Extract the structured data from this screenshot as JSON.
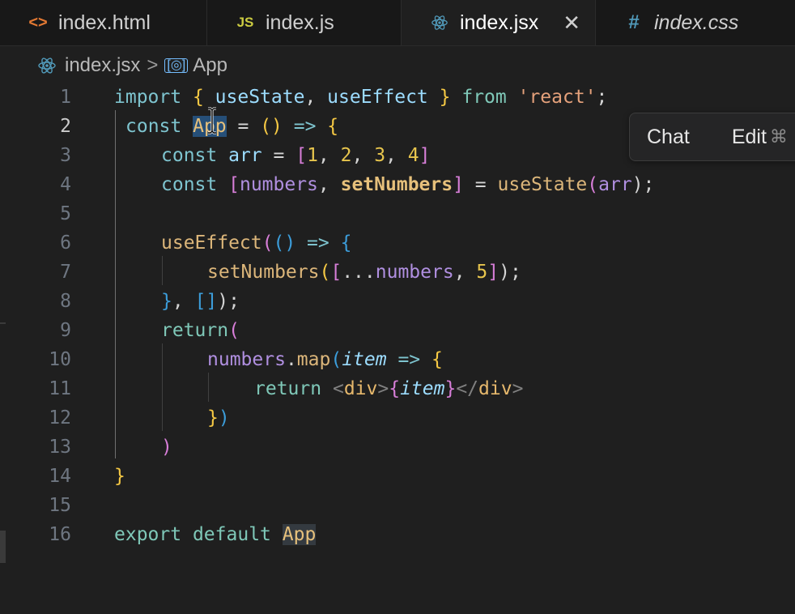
{
  "tabs": [
    {
      "label": "index.html",
      "icon": "html-icon",
      "glyph": "<>",
      "color": "#e37933"
    },
    {
      "label": "index.js",
      "icon": "js-icon",
      "glyph": "JS",
      "color": "#cbcb41"
    },
    {
      "label": "index.jsx",
      "icon": "react-icon",
      "glyph": "⚛",
      "color": "#519aba",
      "close": "✕"
    },
    {
      "label": "index.css",
      "icon": "css-icon",
      "glyph": "#",
      "color": "#519aba"
    }
  ],
  "breadcrumb": {
    "file": "index.jsx",
    "separator": ">",
    "symbol": "App"
  },
  "popup": {
    "chat": "Chat",
    "edit": "Edit",
    "shortcut": "⌘"
  },
  "line_numbers": [
    "1",
    "2",
    "3",
    "4",
    "5",
    "6",
    "7",
    "8",
    "9",
    "10",
    "11",
    "12",
    "13",
    "14",
    "15",
    "16"
  ],
  "code": {
    "l1": [
      "import",
      " ",
      "{",
      " ",
      "useState",
      ", ",
      "useEffect",
      " ",
      "}",
      " ",
      "from",
      " ",
      "'react'",
      ";"
    ],
    "l2": [
      "const",
      " ",
      "App",
      " = ",
      "()",
      " => ",
      "{"
    ],
    "l3": [
      "const",
      " ",
      "arr",
      " = ",
      "[",
      "1",
      ", ",
      "2",
      ", ",
      "3",
      ", ",
      "4",
      "]"
    ],
    "l4": [
      "const",
      " ",
      "[",
      "numbers",
      ", ",
      "setNumbers",
      "]",
      " = ",
      "useState",
      "(",
      "arr",
      ");"
    ],
    "l6": [
      "useEffect",
      "(",
      "()",
      " => ",
      "{"
    ],
    "l7": [
      "setNumbers",
      "(",
      "[",
      "...",
      "numbers",
      ", ",
      "5",
      "]",
      ");"
    ],
    "l8": [
      "}",
      ", ",
      "[]",
      ");"
    ],
    "l9": [
      "return",
      "("
    ],
    "l10": [
      "numbers",
      ".",
      "map",
      "(",
      "item",
      " => ",
      "{"
    ],
    "l11": [
      "return",
      " ",
      "<",
      "div",
      ">",
      "{",
      "item",
      "}",
      "</",
      "div",
      ">"
    ],
    "l12": [
      "}",
      ")"
    ],
    "l13": [
      ")"
    ],
    "l14": [
      "}"
    ],
    "l16": [
      "export",
      " ",
      "default",
      " ",
      "App"
    ]
  }
}
